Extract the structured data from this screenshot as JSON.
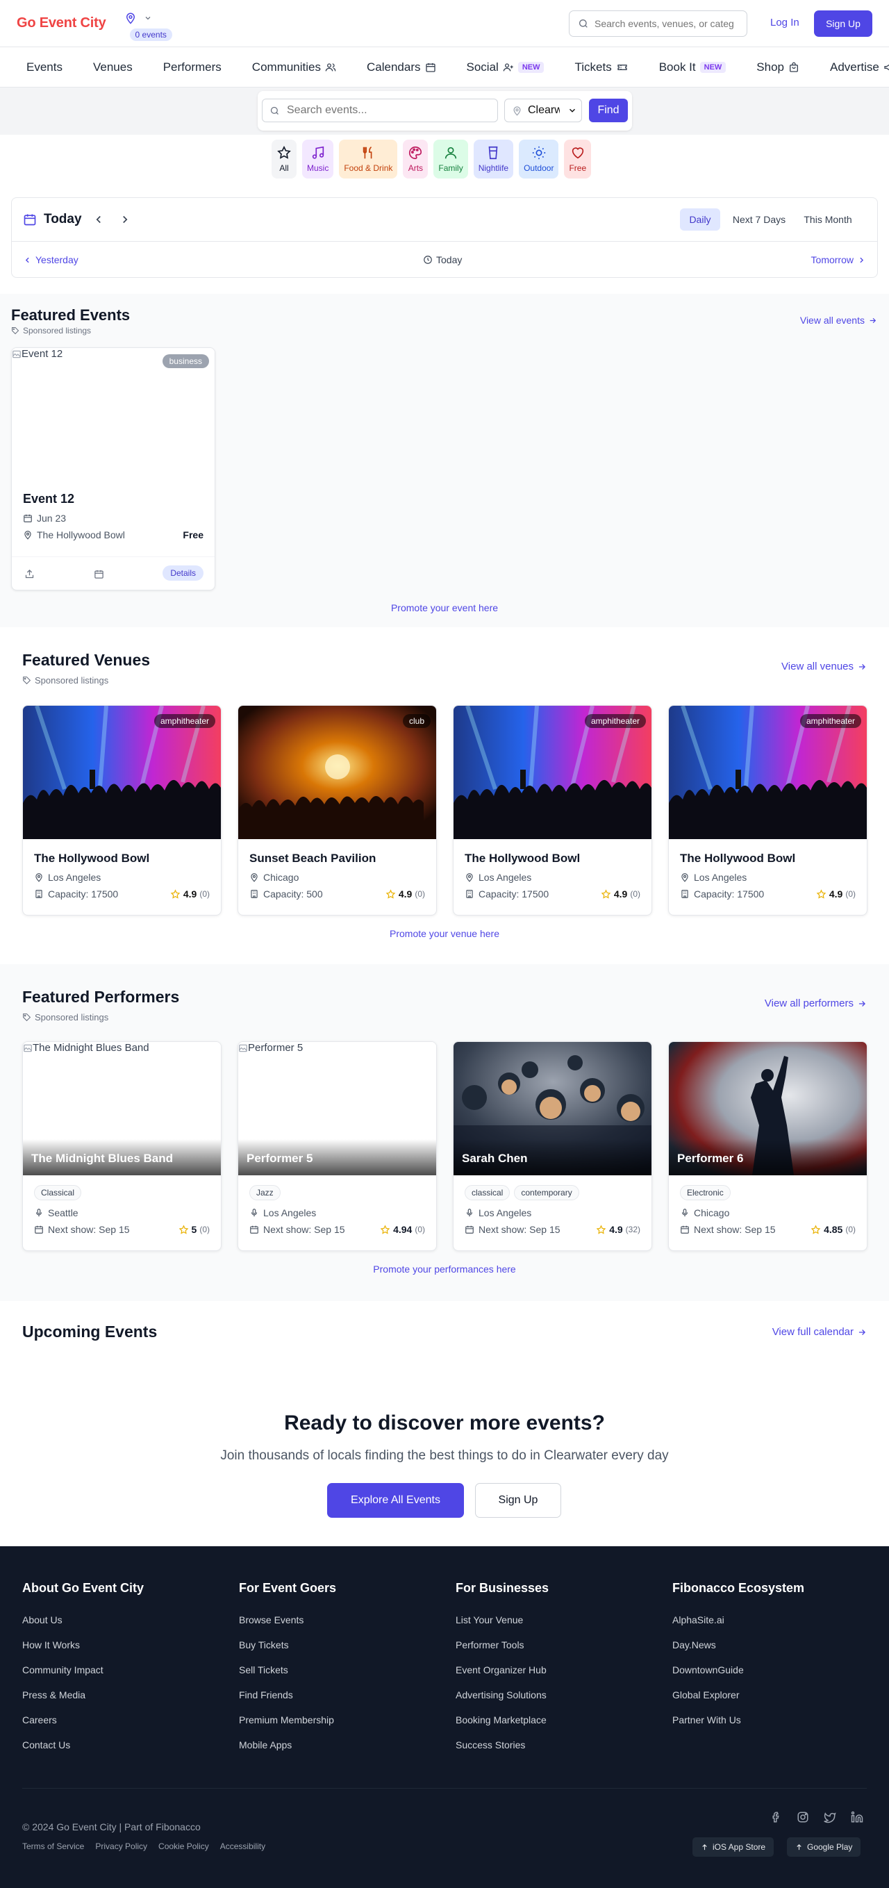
{
  "header": {
    "logo": "Go Event City",
    "events_count": "0 events",
    "search_placeholder": "Search events, venues, or categories",
    "login": "Log In",
    "signup": "Sign Up"
  },
  "nav": {
    "items": [
      "Events",
      "Venues",
      "Performers",
      "Communities",
      "Calendars",
      "Social",
      "Tickets",
      "Book It",
      "Shop",
      "Advertise"
    ],
    "new_badge": "NEW"
  },
  "search": {
    "placeholder": "Search events...",
    "location": "Clearwater",
    "find": "Find"
  },
  "categories": [
    {
      "label": "All",
      "icon": "star-icon",
      "bg": "#f3f4f6",
      "fg": "#111827"
    },
    {
      "label": "Music",
      "icon": "music-icon",
      "bg": "#f3e8ff",
      "fg": "#7e22ce"
    },
    {
      "label": "Food & Drink",
      "icon": "utensils-icon",
      "bg": "#ffedd5",
      "fg": "#c2410c"
    },
    {
      "label": "Arts",
      "icon": "palette-icon",
      "bg": "#fce7f3",
      "fg": "#be185d"
    },
    {
      "label": "Family",
      "icon": "family-icon",
      "bg": "#dcfce7",
      "fg": "#15803d"
    },
    {
      "label": "Nightlife",
      "icon": "glass-icon",
      "bg": "#e0e7ff",
      "fg": "#4338ca"
    },
    {
      "label": "Outdoor",
      "icon": "sun-icon",
      "bg": "#dbeafe",
      "fg": "#1d4ed8"
    },
    {
      "label": "Free",
      "icon": "heart-icon",
      "bg": "#fee2e2",
      "fg": "#b91c1c"
    }
  ],
  "date_nav": {
    "today": "Today",
    "tabs": [
      "Daily",
      "Next 7 Days",
      "This Month"
    ],
    "active_tab": "Daily",
    "yesterday": "Yesterday",
    "current": "Today",
    "tomorrow": "Tomorrow"
  },
  "featured_events": {
    "title": "Featured Events",
    "sponsored": "Sponsored listings",
    "view_all": "View all events",
    "promote": "Promote your event here",
    "events": [
      {
        "title": "Event 12",
        "image_alt": "Event 12",
        "category": "business",
        "date": "Jun 23",
        "venue": "The Hollywood Bowl",
        "price": "Free",
        "details": "Details"
      }
    ]
  },
  "featured_venues": {
    "title": "Featured Venues",
    "sponsored": "Sponsored listings",
    "view_all": "View all venues",
    "promote": "Promote your venue here",
    "venues": [
      {
        "name": "The Hollywood Bowl",
        "type": "amphitheater",
        "city": "Los Angeles",
        "capacity": "Capacity: 17500",
        "rating": "4.9",
        "count": "(0)"
      },
      {
        "name": "Sunset Beach Pavilion",
        "type": "club",
        "city": "Chicago",
        "capacity": "Capacity: 500",
        "rating": "4.9",
        "count": "(0)"
      },
      {
        "name": "The Hollywood Bowl",
        "type": "amphitheater",
        "city": "Los Angeles",
        "capacity": "Capacity: 17500",
        "rating": "4.9",
        "count": "(0)"
      },
      {
        "name": "The Hollywood Bowl",
        "type": "amphitheater",
        "city": "Los Angeles",
        "capacity": "Capacity: 17500",
        "rating": "4.9",
        "count": "(0)"
      }
    ]
  },
  "featured_performers": {
    "title": "Featured Performers",
    "sponsored": "Sponsored listings",
    "view_all": "View all performers",
    "promote": "Promote your performances here",
    "performers": [
      {
        "name": "The Midnight Blues Band",
        "image_alt": "The Midnight Blues Band",
        "tags": [
          "Classical"
        ],
        "city": "Seattle",
        "next_show": "Next show: Sep 15",
        "rating": "5",
        "count": "(0)"
      },
      {
        "name": "Performer 5",
        "image_alt": "Performer 5",
        "tags": [
          "Jazz"
        ],
        "city": "Los Angeles",
        "next_show": "Next show: Sep 15",
        "rating": "4.94",
        "count": "(0)"
      },
      {
        "name": "Sarah Chen",
        "image_alt": "",
        "tags": [
          "classical",
          "contemporary"
        ],
        "city": "Los Angeles",
        "next_show": "Next show: Sep 15",
        "rating": "4.9",
        "count": "(32)"
      },
      {
        "name": "Performer 6",
        "image_alt": "",
        "tags": [
          "Electronic"
        ],
        "city": "Chicago",
        "next_show": "Next show: Sep 15",
        "rating": "4.85",
        "count": "(0)"
      }
    ]
  },
  "upcoming": {
    "title": "Upcoming Events",
    "view_all": "View full calendar"
  },
  "cta": {
    "title": "Ready to discover more events?",
    "subtitle": "Join thousands of locals finding the best things to do in Clearwater every day",
    "primary": "Explore All Events",
    "secondary": "Sign Up"
  },
  "footer": {
    "columns": [
      {
        "title": "About Go Event City",
        "links": [
          "About Us",
          "How It Works",
          "Community Impact",
          "Press & Media",
          "Careers",
          "Contact Us"
        ]
      },
      {
        "title": "For Event Goers",
        "links": [
          "Browse Events",
          "Buy Tickets",
          "Sell Tickets",
          "Find Friends",
          "Premium Membership",
          "Mobile Apps"
        ]
      },
      {
        "title": "For Businesses",
        "links": [
          "List Your Venue",
          "Performer Tools",
          "Event Organizer Hub",
          "Advertising Solutions",
          "Booking Marketplace",
          "Success Stories"
        ]
      },
      {
        "title": "Fibonacco Ecosystem",
        "links": [
          "AlphaSite.ai",
          "Day.News",
          "DowntownGuide",
          "Global Explorer",
          "Partner With Us"
        ]
      }
    ],
    "copyright": "© 2024 Go Event City | Part of Fibonacco",
    "legal": [
      "Terms of Service",
      "Privacy Policy",
      "Cookie Policy",
      "Accessibility"
    ],
    "ios": "iOS App Store",
    "android": "Google Play"
  }
}
